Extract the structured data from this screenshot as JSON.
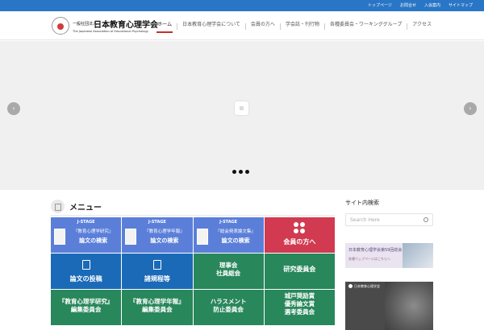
{
  "topbar": {
    "links": [
      "トップページ",
      "お問合せ",
      "入会案内",
      "サイトマップ"
    ]
  },
  "logo": {
    "pre": "一般社団法人",
    "main": "日本教育心理学会",
    "sub": "The Japanese Association of Educational Psychology"
  },
  "nav": {
    "items": [
      {
        "label": "ホーム",
        "active": true
      },
      {
        "label": "日本教育心理学会について"
      },
      {
        "label": "会員の方へ"
      },
      {
        "label": "学会誌・刊行物"
      },
      {
        "label": "各種委員会・ワーキンググループ"
      },
      {
        "label": "アクセス"
      }
    ]
  },
  "slider": {
    "prev": "‹",
    "next": "›",
    "slide_count": 3
  },
  "section": {
    "title": "メニュー"
  },
  "tiles": [
    {
      "type": "jstage",
      "badge": "J-STAGE",
      "l1": "『教育心理学研究』",
      "l2": "論文の検索",
      "color": "blue"
    },
    {
      "type": "jstage",
      "badge": "J-STAGE",
      "l1": "『教育心理学年報』",
      "l2": "論文の検索",
      "color": "blue"
    },
    {
      "type": "jstage",
      "badge": "J-STAGE",
      "l1": "『総会発表論文集』",
      "l2": "論文の検索",
      "color": "blue"
    },
    {
      "type": "red",
      "label": "会員の方へ",
      "color": "red"
    },
    {
      "type": "icon",
      "label": "論文の投稿",
      "color": "blue2"
    },
    {
      "type": "icon",
      "label": "諸規程等",
      "color": "blue2"
    },
    {
      "type": "text",
      "label": "理事会\n社員総会",
      "color": "green"
    },
    {
      "type": "text",
      "label": "研究委員会",
      "color": "green"
    },
    {
      "type": "text",
      "label": "『教育心理学研究』\n編集委員会",
      "color": "green"
    },
    {
      "type": "text",
      "label": "『教育心理学年報』\n編集委員会",
      "color": "green"
    },
    {
      "type": "text",
      "label": "ハラスメント\n防止委員会",
      "color": "green"
    },
    {
      "type": "text",
      "label": "城戸奨励賞\n優秀論文賞\n選考委員会",
      "color": "green"
    }
  ],
  "sidebar": {
    "title": "サイト内検索",
    "search_placeholder": "Search Here",
    "banner1_text": "日本教育心理学会第59回総会",
    "banner1_sub": "各種ウェブページはこちらへ",
    "banner2_text": "日本教育心理学会"
  },
  "colors": {
    "topbar": "#2a76c6",
    "accent": "#c4302b",
    "tile_blue": "#5b7fd9",
    "tile_blue2": "#1b6ab7",
    "tile_green": "#28875b",
    "tile_red": "#d13a50"
  }
}
